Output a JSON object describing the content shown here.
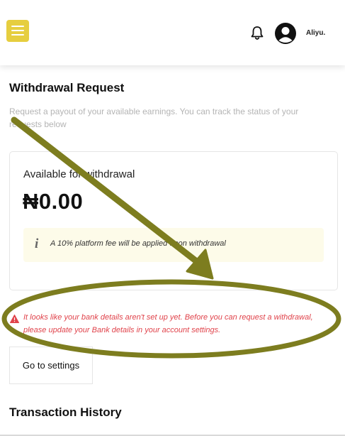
{
  "header": {
    "user_name": "Aliyu.",
    "icons": [
      "menu-icon",
      "bell-icon",
      "user-avatar-icon"
    ],
    "accent_color": "#e6ce3f"
  },
  "main": {
    "title": "Withdrawal Request",
    "description": "Request a payout of your available earnings. You can track the status of your requests below"
  },
  "balance_card": {
    "label": "Available for withdrawal",
    "amount": "₦0.00",
    "fee_note": "A 10% platform fee will be applied upon withdrawal"
  },
  "warning": {
    "text": "It looks like your bank details aren't set up yet. Before you can request a withdrawal, please update your Bank details in your account settings.",
    "color": "#e0434b"
  },
  "settings_button": {
    "label": "Go to settings"
  },
  "history": {
    "title": "Transaction History"
  },
  "annotation": {
    "color": "#7d7d1f",
    "shapes": [
      "arrow",
      "ellipse"
    ]
  }
}
